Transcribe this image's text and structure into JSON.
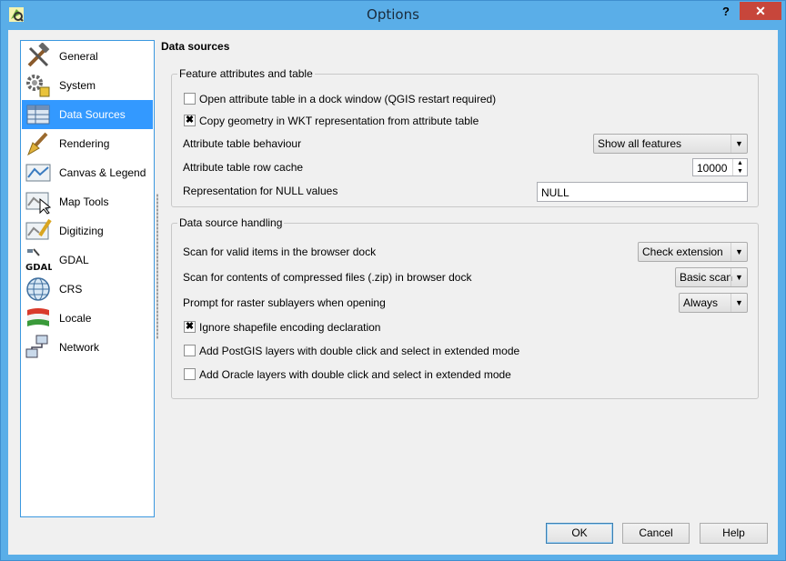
{
  "window": {
    "title": "Options",
    "help_glyph": "?",
    "close_glyph": "✕"
  },
  "sidebar": {
    "items": [
      {
        "label": "General",
        "icon": "tools-icon",
        "active": false
      },
      {
        "label": "System",
        "icon": "gears-icon",
        "active": false
      },
      {
        "label": "Data Sources",
        "icon": "table-icon",
        "active": true
      },
      {
        "label": "Rendering",
        "icon": "brush-icon",
        "active": false
      },
      {
        "label": "Canvas & Legend",
        "icon": "map-legend-icon",
        "active": false
      },
      {
        "label": "Map Tools",
        "icon": "map-cursor-icon",
        "active": false
      },
      {
        "label": "Digitizing",
        "icon": "map-pencil-icon",
        "active": false
      },
      {
        "label": "GDAL",
        "icon": "gdal-satellite-icon",
        "active": false
      },
      {
        "label": "CRS",
        "icon": "globe-icon",
        "active": false
      },
      {
        "label": "Locale",
        "icon": "flag-icon",
        "active": false
      },
      {
        "label": "Network",
        "icon": "network-icon",
        "active": false
      }
    ]
  },
  "content": {
    "title": "Data sources",
    "feature_group": {
      "title": "Feature attributes and table",
      "open_in_dock": {
        "label": "Open attribute table in a dock window (QGIS restart required)",
        "checked": false
      },
      "copy_wkt": {
        "label": "Copy geometry in WKT representation from attribute table",
        "checked": true
      },
      "behaviour": {
        "label": "Attribute table behaviour",
        "value": "Show all features"
      },
      "row_cache": {
        "label": "Attribute table row cache",
        "value": "10000"
      },
      "null_repr": {
        "label": "Representation for NULL values",
        "value": "NULL"
      }
    },
    "handling_group": {
      "title": "Data source handling",
      "scan_valid": {
        "label": "Scan for valid items in the browser dock",
        "value": "Check extension"
      },
      "scan_zip": {
        "label": "Scan for contents of compressed files (.zip) in browser dock",
        "value": "Basic scan"
      },
      "raster_sublayers": {
        "label": "Prompt for raster sublayers when opening",
        "value": "Always"
      },
      "ignore_shp": {
        "label": "Ignore shapefile encoding declaration",
        "checked": true
      },
      "postgis": {
        "label": "Add PostGIS layers with double click and select in extended mode",
        "checked": false
      },
      "oracle": {
        "label": "Add Oracle layers with double click and select in extended mode",
        "checked": false
      }
    }
  },
  "footer": {
    "ok": "OK",
    "cancel": "Cancel",
    "help": "Help"
  },
  "glyphs": {
    "check": "✖",
    "down_arrow": "▼",
    "up_arrow": "▲"
  },
  "colors": {
    "titlebar": "#5aaee8",
    "close": "#c7463b",
    "selection": "#3399ff"
  }
}
